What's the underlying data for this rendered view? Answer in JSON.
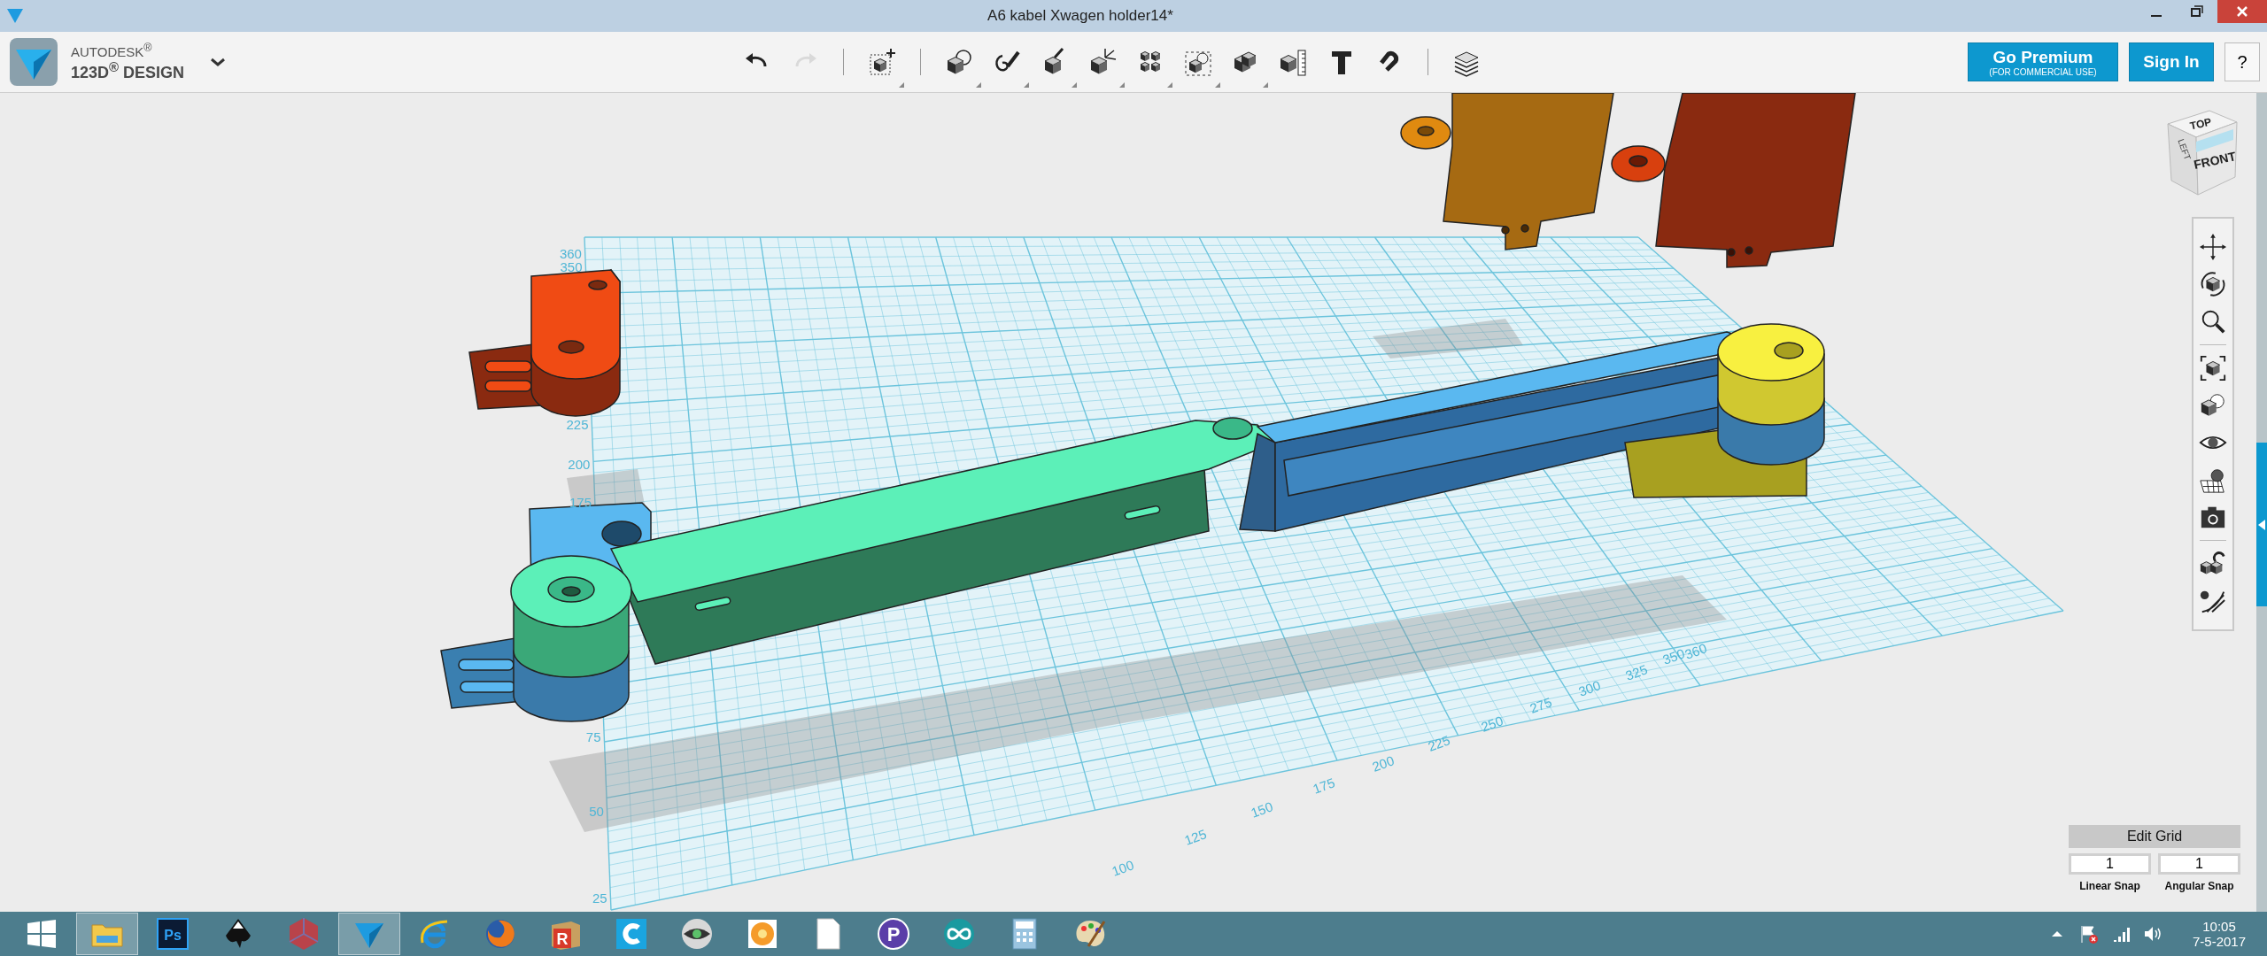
{
  "window": {
    "title": "A6 kabel Xwagen holder14*"
  },
  "app": {
    "brand": "AUTODESK$^{®}$",
    "product": "123D$^{®}$ DESIGN"
  },
  "toolbar": {
    "groups": [
      [
        {
          "kind": "undo",
          "disabled": false,
          "menu": false
        },
        {
          "kind": "redo",
          "disabled": true,
          "menu": false
        }
      ],
      [
        {
          "kind": "primitives",
          "disabled": false,
          "menu": true
        }
      ],
      [
        {
          "kind": "sketch",
          "disabled": false,
          "menu": true
        },
        {
          "kind": "construct",
          "disabled": false,
          "menu": true
        },
        {
          "kind": "modify",
          "disabled": false,
          "menu": true
        },
        {
          "kind": "transform",
          "disabled": false,
          "menu": true
        },
        {
          "kind": "pattern",
          "disabled": false,
          "menu": true
        },
        {
          "kind": "grouping",
          "disabled": false,
          "menu": true
        },
        {
          "kind": "combine",
          "disabled": false,
          "menu": true
        },
        {
          "kind": "measure",
          "disabled": false,
          "menu": false
        },
        {
          "kind": "text",
          "disabled": false,
          "menu": false
        },
        {
          "kind": "snap",
          "disabled": false,
          "menu": false
        }
      ],
      [
        {
          "kind": "material",
          "disabled": false,
          "menu": false
        }
      ]
    ]
  },
  "account": {
    "premium": "Go Premium",
    "premium_note": "(FOR COMMERCIAL USE)",
    "sign_in": "Sign In",
    "help": "?"
  },
  "view_cube": {
    "top": "TOP",
    "front": "FRONT",
    "left": "LEFT"
  },
  "nav_tools": [
    [
      {
        "kind": "pan"
      },
      {
        "kind": "orbit"
      },
      {
        "kind": "zoom"
      }
    ],
    [
      {
        "kind": "fit"
      },
      {
        "kind": "views"
      },
      {
        "kind": "visibility"
      },
      {
        "kind": "grid-visibility"
      },
      {
        "kind": "screenshot"
      }
    ],
    [
      {
        "kind": "snap"
      },
      {
        "kind": "material"
      }
    ]
  ],
  "grid_labels": {
    "side": [
      "360",
      "350",
      "225",
      "200",
      "175",
      "75",
      "50",
      "25"
    ],
    "front": [
      "100",
      "125",
      "150",
      "175",
      "200",
      "225",
      "250",
      "275",
      "300",
      "325",
      "350",
      "360"
    ]
  },
  "edit_grid": {
    "title": "Edit Grid",
    "linear": "1",
    "linear_label": "Linear Snap",
    "angular": "1",
    "angular_label": "Angular Snap"
  },
  "taskbar": {
    "apps": [
      {
        "kind": "start",
        "selected": false
      },
      {
        "kind": "folder",
        "selected": true
      },
      {
        "kind": "photoshop",
        "label": "Ps",
        "selected": false
      },
      {
        "kind": "inkscape",
        "selected": false
      },
      {
        "kind": "polyhedron",
        "selected": false
      },
      {
        "kind": "design",
        "selected": true
      },
      {
        "kind": "browser-e",
        "selected": false
      },
      {
        "kind": "firefox",
        "selected": false
      },
      {
        "kind": "block",
        "label": "R",
        "selected": false
      },
      {
        "kind": "c-app",
        "selected": false
      },
      {
        "kind": "eye",
        "selected": false
      },
      {
        "kind": "flower",
        "selected": false
      },
      {
        "kind": "page",
        "selected": false
      },
      {
        "kind": "p-app",
        "label": "P",
        "selected": false
      },
      {
        "kind": "arduino",
        "selected": false
      },
      {
        "kind": "calculator",
        "selected": false
      },
      {
        "kind": "paint",
        "selected": false
      }
    ],
    "clock": {
      "time": "10:05",
      "date": "7-5-2017"
    }
  }
}
